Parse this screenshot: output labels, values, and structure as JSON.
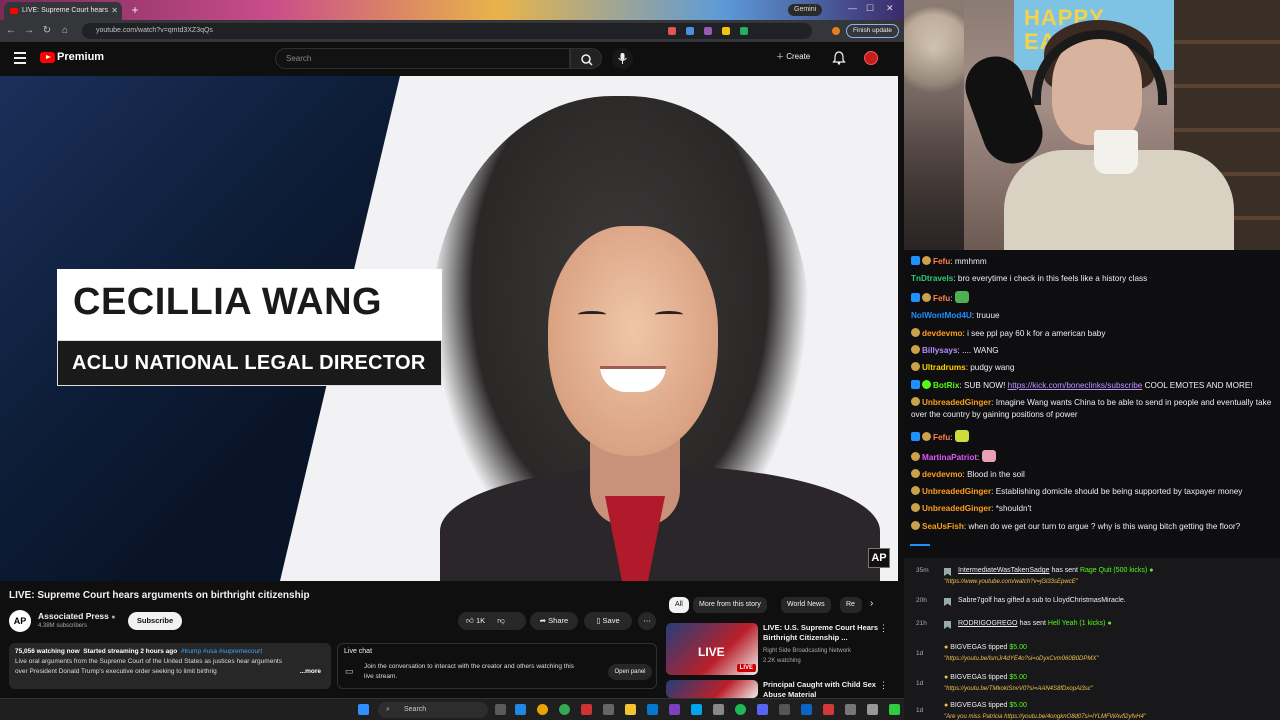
{
  "browser": {
    "tab_title": "LIVE: Supreme Court hears",
    "url": "youtube.com/watch?v=qmtd3XZ3qQs",
    "gemini_label": "Gemini",
    "finish_update": "Finish update"
  },
  "youtube": {
    "logo_text": "Premium",
    "search_placeholder": "Search",
    "create_label": "Create",
    "video": {
      "lower_third_name": "CECILLIA WANG",
      "lower_third_title": "ACLU NATIONAL LEGAL DIRECTOR",
      "ap_logo": "AP",
      "title": "LIVE: Supreme Court hears arguments on birthright citizenship"
    },
    "channel": {
      "logo": "AP",
      "name": "Associated Press",
      "subscribers": "4.38M subscribers",
      "subscribe_label": "Subscribe"
    },
    "actions": {
      "likes": "1K",
      "share": "Share",
      "save": "Save"
    },
    "description": {
      "watching": "75,056 watching now",
      "started": "Started streaming 2 hours ago",
      "tags": "#trump #usa #supremecourt",
      "text": "Live oral arguments from the Supreme Court of the United States as justices hear arguments over President Donald Trump's executive order seeking to limit birthrig",
      "more": "...more"
    },
    "live_chat": {
      "title": "Live chat",
      "text": "Join the conversation to interact with the creator and others watching this live stream.",
      "open_panel": "Open panel"
    },
    "chips": [
      "All",
      "More from this story",
      "World News",
      "Re"
    ],
    "related": [
      {
        "title": "LIVE: U.S. Supreme Court Hears Birthright Citizenship ...",
        "channel": "Right Side Broadcasting Network",
        "meta": "2.2K watching",
        "badge": "LIVE",
        "thumb_text": "LIVE"
      },
      {
        "title": "Principal Caught with Child Sex Abuse Material",
        "channel": "",
        "meta": "",
        "badge": "",
        "thumb_text": ""
      }
    ]
  },
  "taskbar": {
    "search_label": "Search"
  },
  "stream": {
    "poster_text": "HAPPY EASTER"
  },
  "chat": [
    {
      "user": "Fefu",
      "color": "#ff7f50",
      "msg": "mmhmm"
    },
    {
      "user": "TnDtravels",
      "color": "#2ecc71",
      "msg": "bro everytime i check in this feels like a history class"
    },
    {
      "user": "Fefu",
      "color": "#ff7f50",
      "msg": ""
    },
    {
      "user": "NolWontMod4U",
      "color": "#1e90ff",
      "msg": "truuue"
    },
    {
      "user": "devdevmo",
      "color": "#ff9f1a",
      "msg": "i see ppl pay 60 k for a american baby"
    },
    {
      "user": "Billysays",
      "color": "#b48cff",
      "msg": ".... WANG"
    },
    {
      "user": "Ultradrums",
      "color": "#ffd400",
      "msg": "pudgy wang"
    },
    {
      "user": "BotRix",
      "color": "#53fc18",
      "msg": "SUB NOW!",
      "link": "https://kick.com/boneclinks/subscribe",
      "tail": "COOL EMOTES AND MORE!"
    },
    {
      "user": "UnbreadedGinger",
      "color": "#ff9f1a",
      "msg": "Imagine Wang wants China to be able to send in people and eventually take over the country by gaining positions of power"
    },
    {
      "user": "Fefu",
      "color": "#ff7f50",
      "msg": ""
    },
    {
      "user": "MartinaPatriot",
      "color": "#e056fd",
      "msg": ""
    },
    {
      "user": "devdevmo",
      "color": "#ff9f1a",
      "msg": "Blood in the soil"
    },
    {
      "user": "UnbreadedGinger",
      "color": "#ff9f1a",
      "msg": "Establishing domicile should be being supported by taxpayer money"
    },
    {
      "user": "UnbreadedGinger",
      "color": "#ff9f1a",
      "msg": "*shouldn't"
    },
    {
      "user": "SeaUsFish",
      "color": "#ff9f1a",
      "msg": "when do we get our turn to argue ? why is this wang bitch getting the floor?"
    }
  ],
  "events": [
    {
      "time": "35m",
      "user": "IntermediateWasTakenSadge",
      "text": "has sent",
      "item": "Rage Quit (500 kicks)",
      "link": "\"https://www.youtube.com/watch?v=jGl33sEpwcE\""
    },
    {
      "time": "20h",
      "user": "Sabre7golf",
      "text": "has gifted a sub to",
      "item": "LloydChristmasMiracle.",
      "link": ""
    },
    {
      "time": "21h",
      "user": "RODRIGOGREGO",
      "text": "has sent",
      "item": "Hell Yeah (1 kicks)",
      "link": ""
    },
    {
      "time": "1d",
      "user": "BIGVEGAS",
      "text": "tipped",
      "item": "$5.00",
      "link": "\"https://youtu.be/lsmJr4dYE4o?si=oDyxCvm060B0DPMX\""
    },
    {
      "time": "1d",
      "user": "BIGVEGAS",
      "text": "tipped",
      "item": "$5.00",
      "link": "\"https://youtu.be/TMkokISnvV0?si=AAN4S8fDxopAl3sc\""
    },
    {
      "time": "1d",
      "user": "BIGVEGAS",
      "text": "tipped",
      "item": "$5.00",
      "link": "\"Are you miss Patricia https://youtu.be/4ongknO8d07si=lYLMFWAvfl2yfvH4\""
    }
  ]
}
